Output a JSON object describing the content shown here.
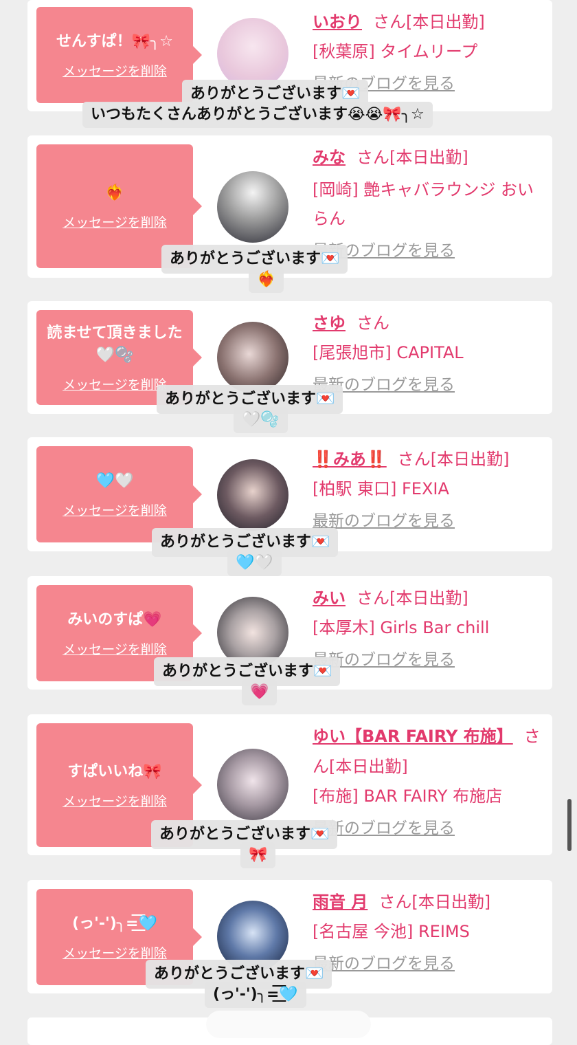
{
  "delete_label": "メッセージを削除",
  "san_label": "さん",
  "blog_label": "最新のブログを見る",
  "cards": [
    {
      "bubble": "せんすぱ！🎀╮☆",
      "name": "いおり",
      "status": "[本日出勤]",
      "shop": "[秋葉原] タイムリープ",
      "toast_main": "ありがとうございます💌",
      "toast_sub": "いつもたくさんありがとうございます😭😭🎀╮☆"
    },
    {
      "bubble": "❤️‍🔥",
      "name": "みな",
      "status": "[本日出勤]",
      "shop": "[岡崎] 艶キャバラウンジ おいらん",
      "toast_main": "ありがとうございます💌",
      "toast_sub": "❤️‍🔥"
    },
    {
      "bubble": "読ませて頂きました🤍🫧",
      "name": "さゆ",
      "status": "",
      "shop": "[尾張旭市] CAPITAL",
      "toast_main": "ありがとうございます💌",
      "toast_sub": "🤍🫧"
    },
    {
      "bubble": "🩵🤍",
      "name": "‼️みあ‼️",
      "status": "[本日出勤]",
      "shop": "[柏駅 東口] FEXIA",
      "toast_main": "ありがとうございます💌",
      "toast_sub": "🩵🤍"
    },
    {
      "bubble": "みいのすぱ💗",
      "name": "みい",
      "status": "[本日出勤]",
      "shop": "[本厚木] Girls Bar chill",
      "toast_main": "ありがとうございます💌",
      "toast_sub": "💗"
    },
    {
      "bubble": "すぱいいね🎀",
      "name": "ゆい【BAR FAIRY 布施】",
      "status": "[本日出勤]",
      "shop": "[布施] BAR FAIRY 布施店",
      "toast_main": "ありがとうございます💌",
      "toast_sub": "🎀"
    },
    {
      "bubble": "(っ'-')╮=͟͟͞͞🩵",
      "name": "雨音 月",
      "status": "[本日出勤]",
      "shop": "[名古屋 今池] REIMS",
      "toast_main": "ありがとうございます💌",
      "toast_sub": "(っ'-')╮=͟͟͞͞🩵"
    }
  ]
}
